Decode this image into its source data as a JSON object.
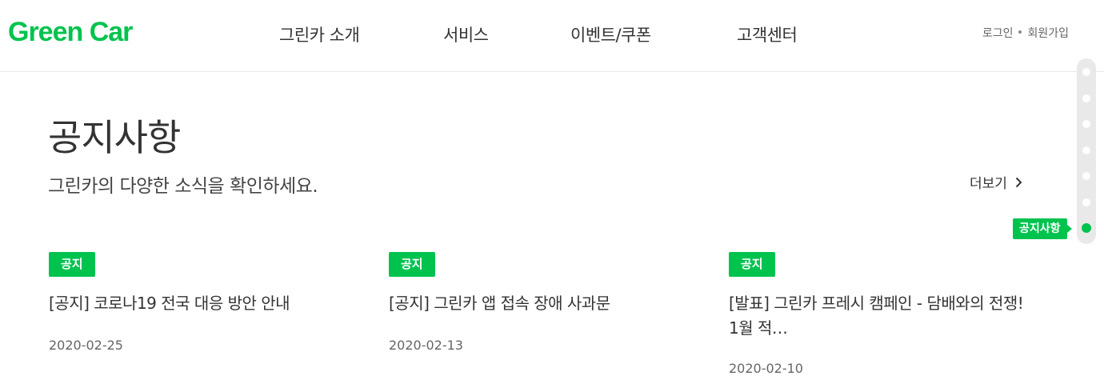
{
  "brand": {
    "name": "Green Car",
    "color": "#00c34e"
  },
  "nav": {
    "items": [
      {
        "label": "그린카 소개"
      },
      {
        "label": "서비스"
      },
      {
        "label": "이벤트/쿠폰"
      },
      {
        "label": "고객센터"
      }
    ],
    "login": "로그인",
    "signup": "회원가입"
  },
  "section": {
    "title": "공지사항",
    "description": "그린카의 다양한 소식을 확인하세요.",
    "more": "더보기",
    "more_icon": "chevron-right-icon"
  },
  "notices": [
    {
      "badge": "공지",
      "title": "[공지] 코로나19 전국 대응 방안 안내",
      "date": "2020-02-25"
    },
    {
      "badge": "공지",
      "title": "[공지] 그린카 앱 접속 장애 사과문",
      "date": "2020-02-13"
    },
    {
      "badge": "공지",
      "title": "[발표] 그린카 프레시 캠페인 - 담배와의 전쟁! 1월 적…",
      "date": "2020-02-10"
    }
  ],
  "scroll_nav": {
    "active_label": "공지사항",
    "dot_count": 7,
    "active_index": 6
  }
}
